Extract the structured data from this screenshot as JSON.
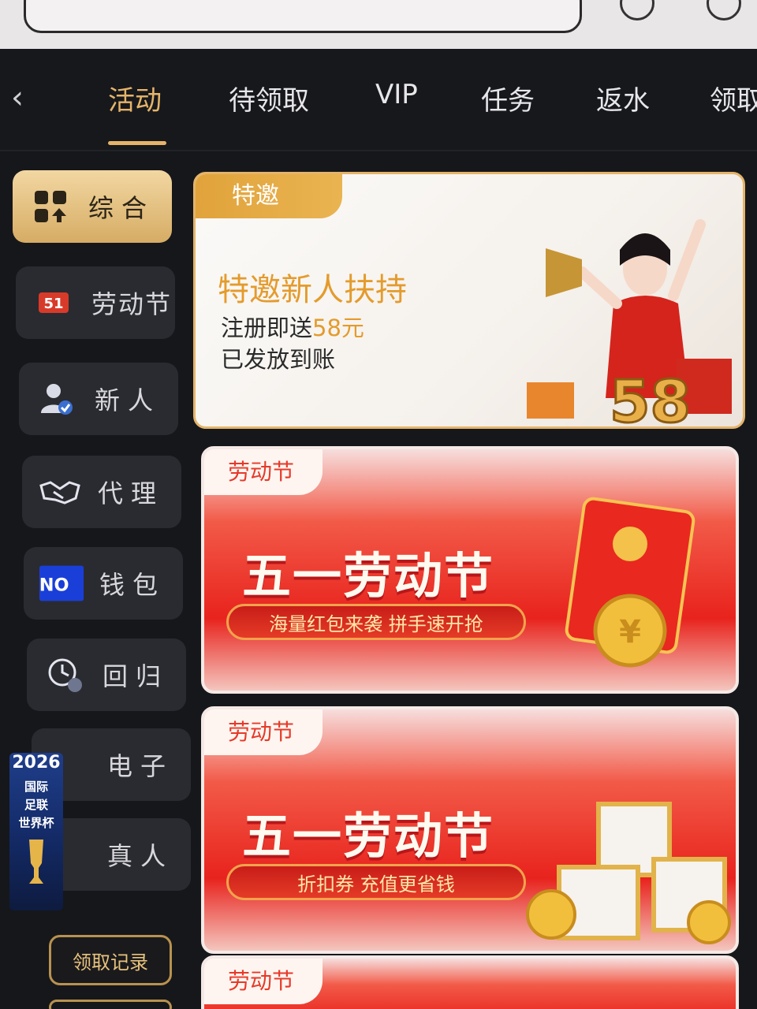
{
  "tabs": [
    {
      "label": "活动",
      "active": true
    },
    {
      "label": "待领取"
    },
    {
      "label": "VIP"
    },
    {
      "label": "任务"
    },
    {
      "label": "返水"
    },
    {
      "label": "领取"
    }
  ],
  "sidebar": {
    "items": [
      {
        "label": "综合",
        "icon": "grid-icon",
        "active": true
      },
      {
        "label": "劳动节",
        "icon": "labor-day-badge-icon",
        "badge": "51"
      },
      {
        "label": "新人",
        "icon": "new-user-icon"
      },
      {
        "label": "代理",
        "icon": "handshake-icon"
      },
      {
        "label": "钱包",
        "icon": "wallet-logo-icon",
        "badge": "NO"
      },
      {
        "label": "回归",
        "icon": "return-clock-icon"
      },
      {
        "label": "电子",
        "icon": "electronic-icon"
      },
      {
        "label": "真人",
        "icon": "live-icon"
      }
    ],
    "record_button": "领取记录"
  },
  "float_ad": {
    "year": "2026",
    "line1": "国际",
    "line2": "足联",
    "line3": "世界杯"
  },
  "cards": {
    "invite": {
      "tag": "特邀",
      "title": "特邀新人扶持",
      "line1_prefix": "注册即送",
      "line1_amount": "58元",
      "line2": "已发放到账",
      "badge_number": "58"
    },
    "labor1": {
      "tag": "劳动节",
      "title": "五一劳动节",
      "subtitle": "海量红包来袭 拼手速开抢"
    },
    "labor2": {
      "tag": "劳动节",
      "title": "五一劳动节",
      "subtitle": "折扣券 充值更省钱"
    },
    "labor3": {
      "tag": "劳动节"
    }
  },
  "colors": {
    "accent": "#e5b46a",
    "background": "#16171b",
    "red": "#e8231d"
  }
}
